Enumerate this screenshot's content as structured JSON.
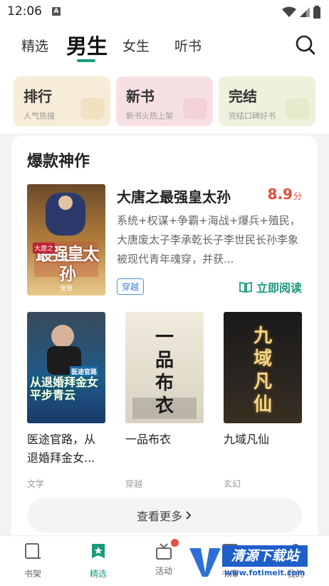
{
  "status": {
    "time": "12:06",
    "notif": "A"
  },
  "nav": {
    "tabs": [
      "精选",
      "男生",
      "女生",
      "听书"
    ],
    "active": "男生"
  },
  "categories": [
    {
      "title": "排行",
      "sub": "人气热搜"
    },
    {
      "title": "新书",
      "sub": "新书火热上架"
    },
    {
      "title": "完结",
      "sub": "完结口碑好书"
    }
  ],
  "section": {
    "title": "爆款神作"
  },
  "featured": {
    "name": "大唐之最强皇太孙",
    "score": "8.9",
    "score_unit": "分",
    "description": "系统+权谋+争霸+海战+爆兵+殖民，大唐废太子李承乾长子李世民长孙李象被现代青年魂穿，并获...",
    "tag": "穿越",
    "read_label": "立即阅读",
    "cover": {
      "big": "最强皇太孙",
      "small": "大唐之",
      "author": "宝哥"
    }
  },
  "books": [
    {
      "name": "医途官路，从退婚拜金女...",
      "genre": "文学",
      "cover_text": "从退婚拜金女平步青云",
      "cover_small": "医途官路"
    },
    {
      "name": "一品布衣",
      "genre": "穿越",
      "cover_text": "一品布衣"
    },
    {
      "name": "九域凡仙",
      "genre": "玄幻",
      "cover_text": "九域凡仙"
    }
  ],
  "more_label": "查看更多",
  "bottom": [
    {
      "label": "书架"
    },
    {
      "label": "精选"
    },
    {
      "label": "活动"
    },
    {
      "label": "书库"
    },
    {
      "label": "我的"
    }
  ],
  "watermark": {
    "text": "清源下载站",
    "url": "www.fotimeit.com"
  },
  "colors": {
    "accent": "#1b9a7c",
    "score": "#e04e3c",
    "tag": "#3f7ed6"
  }
}
